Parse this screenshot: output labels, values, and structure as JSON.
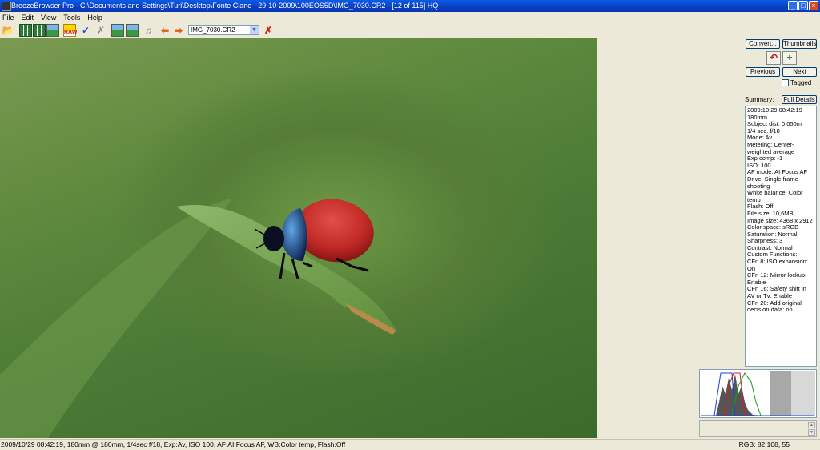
{
  "window": {
    "title": "BreezeBrowser Pro - C:\\Documents and Settings\\Turi\\Desktop\\Fonte Clane - 29-10-2009\\100EOS5D\\IMG_7030.CR2 - [12 of 115] HQ"
  },
  "menu": [
    "File",
    "Edit",
    "View",
    "Tools",
    "Help"
  ],
  "toolbar": {
    "file_select_value": "IMG_7030.CR2",
    "raw_label": "RAW"
  },
  "panel": {
    "convert_label": "Convert...",
    "thumbnails_label": "Thumbnails",
    "previous_label": "Previous",
    "next_label": "Next",
    "tagged_label": "Tagged",
    "summary_label": "Summary:",
    "full_details_label": "Full Details",
    "summary_lines": [
      "2009:10:29 08:42:19",
      "180mm",
      "Subject dist: 0,050m",
      "1/4 sec. f/18",
      "Mode: Av",
      "Metering: Center-weighted average",
      "Exp comp: -1",
      "ISO: 100",
      "AF mode: AI Focus AF",
      "Drive: Single frame shooting",
      "White balance: Color temp",
      "Flash: Off",
      "File size: 10,6MB",
      "Image size: 4368 x 2912",
      "Color space: sRGB",
      "Saturation: Normal",
      "Sharpness: 3",
      "Contrast: Normal",
      "Custom Functions:",
      "CFn 8: ISO expansion: On",
      "CFn 12: Mirror lockup: Enable",
      "CFn 16: Safety shift in AV or Tv: Enable",
      "CFn 20: Add original decision data: on"
    ]
  },
  "status": {
    "left": "2009/10/29 08:42:19, 180mm @ 180mm, 1/4sec f/18, Exp:Av, ISO 100, AF:AI Focus AF, WB:Color temp, Flash:Off",
    "rgb": "RGB:   82,108, 55"
  }
}
